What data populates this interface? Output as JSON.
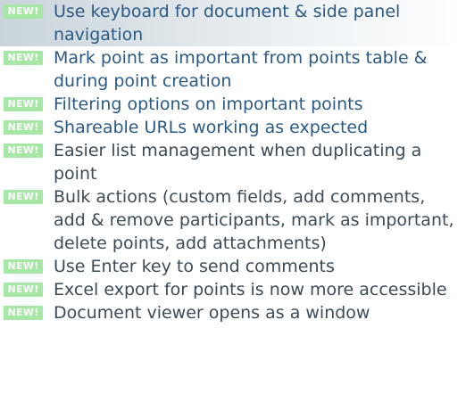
{
  "badge_label": "NEW!",
  "colors": {
    "badge_bg": "#a7e7a5",
    "link_text": "#2a5a85",
    "body_text": "#3b4b58",
    "highlight": "#c9d4da"
  },
  "items": [
    {
      "text": "Use keyboard for document & side panel navigation",
      "icon": "new-badge-icon"
    },
    {
      "text": "Mark point as important from points table & during point creation",
      "icon": "new-badge-icon"
    },
    {
      "text": "Filtering options on important points",
      "icon": "new-badge-icon"
    },
    {
      "text": "Shareable URLs working as expected",
      "icon": "new-badge-icon"
    },
    {
      "text": "Easier list management when duplicating a point",
      "icon": "new-badge-icon"
    },
    {
      "text": "Bulk actions (custom fields, add comments, add & remove participants, mark as important, delete points, add attachments)",
      "icon": "new-badge-icon"
    },
    {
      "text": "Use Enter key to send comments",
      "icon": "new-badge-icon"
    },
    {
      "text": "Excel export for points is now more accessible",
      "icon": "new-badge-icon"
    },
    {
      "text": "Document viewer opens as a window",
      "icon": "new-badge-icon"
    }
  ]
}
